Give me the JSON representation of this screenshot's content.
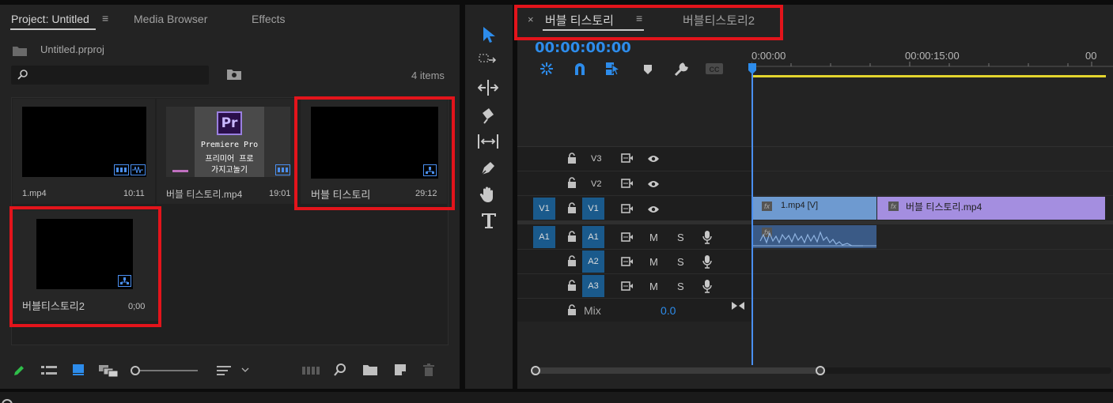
{
  "project": {
    "tabs": [
      {
        "label": "Project: Untitled"
      },
      {
        "label": "Media Browser"
      },
      {
        "label": "Effects"
      }
    ],
    "file_name": "Untitled.prproj",
    "search_placeholder": "",
    "item_count": "4 items",
    "items": [
      {
        "name": "1.mp4",
        "duration": "10:11"
      },
      {
        "name": "버블 티스토리.mp4",
        "duration": "19:01",
        "thumb_lines": [
          "Premiere Pro",
          "프리미어 프로",
          "가지고놀기"
        ]
      },
      {
        "name": "버블 티스토리",
        "duration": "29:12"
      },
      {
        "name": "버블티스토리2",
        "duration": "0;00"
      }
    ]
  },
  "timeline": {
    "tabs": [
      {
        "label": "버블 티스토리"
      },
      {
        "label": "버블티스토리2"
      }
    ],
    "timecode": "00:00:00:00",
    "ruler": [
      "0:00:00",
      "00:00:15:00",
      "00"
    ],
    "video_tracks": [
      {
        "label": "V3"
      },
      {
        "label": "V2"
      },
      {
        "label": "V1",
        "source": "V1"
      }
    ],
    "audio_tracks": [
      {
        "label": "A1",
        "source": "A1"
      },
      {
        "label": "A2"
      },
      {
        "label": "A3"
      }
    ],
    "mute_label": "M",
    "solo_label": "S",
    "mix_label": "Mix",
    "mix_value": "0.0",
    "clips": [
      {
        "label": "1.mp4 [V]"
      },
      {
        "label": "버블 티스토리.mp4"
      }
    ],
    "fx_label": "fx"
  },
  "colors": {
    "accent": "#2d8ceb",
    "highlight": "#e3141b",
    "clip_video_1": "#6e9ad0",
    "clip_video_2": "#a48ee0",
    "clip_audio": "#3a5a86",
    "playhead": "#4a8ff0",
    "workarea": "#e4d52e"
  }
}
